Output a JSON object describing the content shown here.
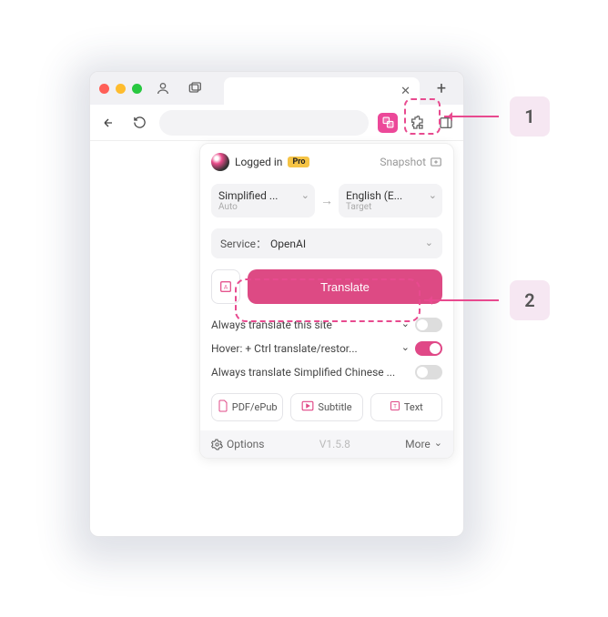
{
  "callouts": {
    "one": "1",
    "two": "2"
  },
  "popup": {
    "logged_in": "Logged in",
    "pro": "Pro",
    "snapshot": "Snapshot",
    "source_lang": "Simplified ...",
    "source_sub": "Auto",
    "target_lang": "English (E...",
    "target_sub": "Target",
    "service_label": "Service：",
    "service_value": "OpenAI",
    "translate": "Translate",
    "always_site": "Always translate this site",
    "hover": "Hover:  + Ctrl translate/restor...",
    "always_lang": "Always translate Simplified Chinese ...",
    "pdf": "PDF/ePub",
    "subtitle": "Subtitle",
    "text": "Text",
    "options": "Options",
    "version": "V1.5.8",
    "more": "More"
  }
}
